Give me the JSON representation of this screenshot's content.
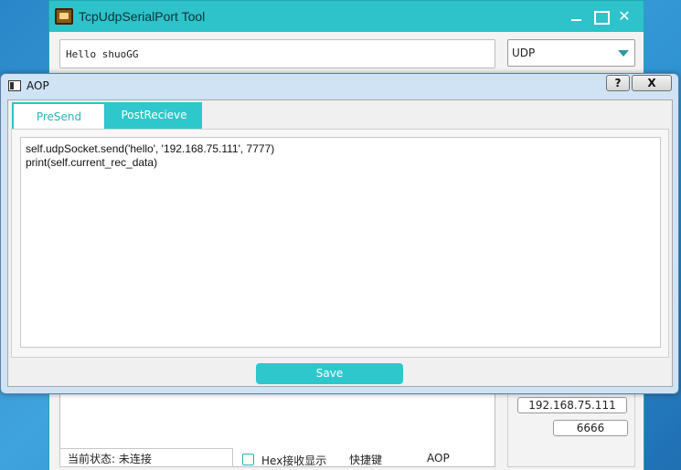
{
  "main_window": {
    "title": "TcpUdpSerialPort Tool",
    "send_text": "Hello shuoGG",
    "protocol": "UDP",
    "remote_ip": "192.168.75.111",
    "remote_port": "6666",
    "status": "当前状态: 未连接",
    "hex_recv_label": "Hex接收显示",
    "shortcut_label": "快捷键",
    "aop_label": "AOP",
    "controls": {
      "minimize": "",
      "maximize": "",
      "close": "✕"
    }
  },
  "dialog": {
    "title": "AOP",
    "help_label": "?",
    "close_label": "X",
    "tabs": [
      {
        "label": "PreSend",
        "active": true
      },
      {
        "label": "PostRecieve",
        "active": false
      }
    ],
    "code_lines": [
      "self.udpSocket.send('hello', '192.168.75.111', 7777)",
      "print(self.current_rec_data)"
    ],
    "save_label": "Save"
  },
  "colors": {
    "accent": "#2ec7cc",
    "title_bar": "#2ec2ca",
    "dialog_frame": "#cfe3f4"
  }
}
